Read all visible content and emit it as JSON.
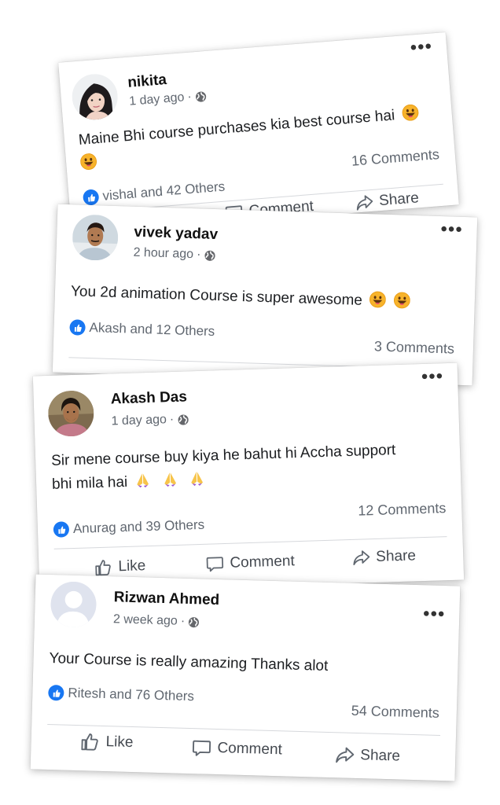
{
  "posts": [
    {
      "author": "nikita",
      "time": "1 day ago",
      "text": "Maine Bhi course purchases kia best course hai",
      "reactions": "vishal and 42 Others",
      "comments": "16 Comments"
    },
    {
      "author": "vivek yadav",
      "time": "2 hour ago",
      "text": "You 2d animation Course is super awesome",
      "reactions": "Akash and 12 Others",
      "comments": "3 Comments"
    },
    {
      "author": "Akash Das",
      "time": "1 day ago",
      "text_line1": "Sir mene course buy kiya he bahut hi Accha support",
      "text_line2": "bhi mila hai",
      "reactions": "Anurag and 39 Others",
      "comments": "12 Comments"
    },
    {
      "author": "Rizwan Ahmed",
      "time": "2 week ago",
      "text": "Your Course is really amazing Thanks alot",
      "reactions": "Ritesh and 76 Others",
      "comments": "54 Comments"
    }
  ],
  "actions": {
    "like": "Like",
    "comment": "Comment",
    "share": "Share"
  },
  "more_glyph": "•••",
  "meta_separator": "·",
  "colors": {
    "like_blue": "#1877f2",
    "meta_gray": "#606770"
  },
  "icons": [
    "more-options-icon",
    "globe-icon",
    "like-badge-icon",
    "thumbs-up-icon",
    "comment-icon",
    "share-icon",
    "smiley-emoji",
    "folded-hands-emoji",
    "default-avatar-icon"
  ]
}
